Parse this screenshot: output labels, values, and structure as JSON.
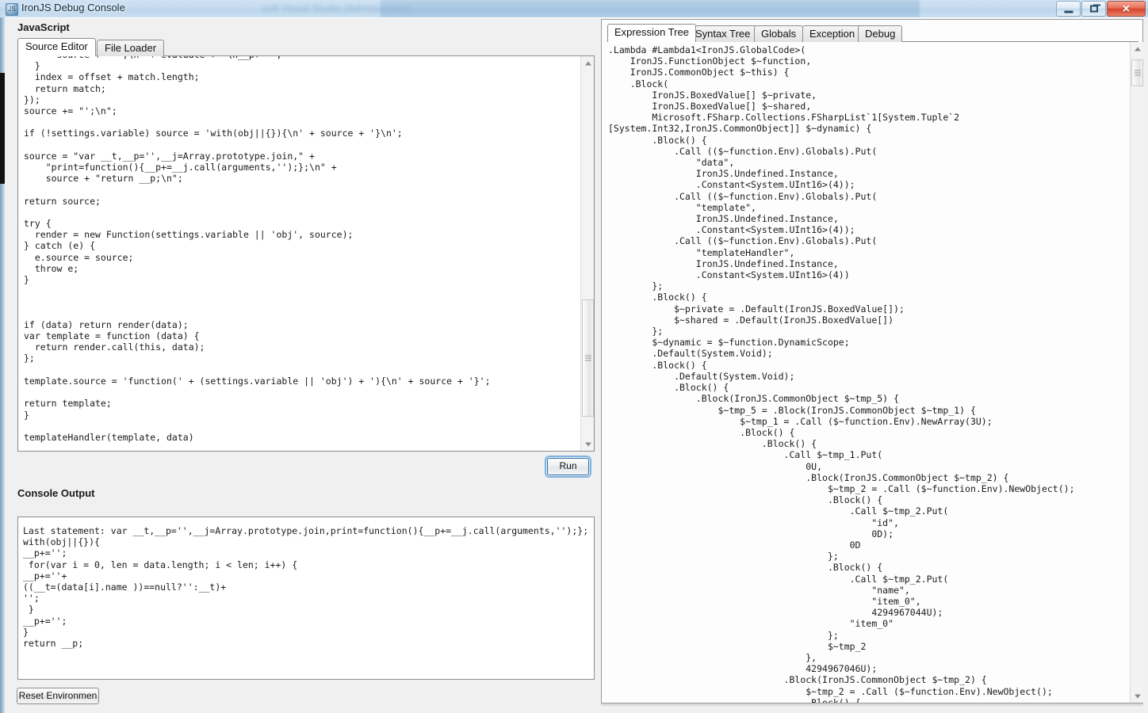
{
  "window": {
    "title": "IronJS Debug Console",
    "ghost_title": "soft Visual Studio (Administrator)",
    "icon": "app-icon",
    "controls": {
      "minimize": "minimize-icon",
      "restore": "restore-icon",
      "close": "close-icon"
    }
  },
  "left": {
    "javascript_label": "JavaScript",
    "console_label": "Console Output",
    "tabs": [
      {
        "label": "Source Editor",
        "active": true
      },
      {
        "label": "File Loader",
        "active": false
      }
    ],
    "run_button": "Run",
    "reset_button": "Reset Environmen",
    "editor_code": "      source += \"';\\n' + evaluate + '\\n__p+='\";\n  }\n  index = offset + match.length;\n  return match;\n});\nsource += \"';\\n\";\n\nif (!settings.variable) source = 'with(obj||{}){\\n' + source + '}\\n';\n\nsource = \"var __t,__p='',__j=Array.prototype.join,\" +\n    \"print=function(){__p+=__j.call(arguments,'');};\\n\" +\n    source + \"return __p;\\n\";\n\nreturn source;\n\ntry {\n  render = new Function(settings.variable || 'obj', source);\n} catch (e) {\n  e.source = source;\n  throw e;\n}\n\n\n\nif (data) return render(data);\nvar template = function (data) {\n  return render.call(this, data);\n};\n\ntemplate.source = 'function(' + (settings.variable || 'obj') + '){\\n' + source + '}';\n\nreturn template;\n}\n\ntemplateHandler(template, data)\n",
    "console_output": "Last statement: var __t,__p='',__j=Array.prototype.join,print=function(){__p+=__j.call(arguments,'');};\nwith(obj||{}){\n__p+='';\n for(var i = 0, len = data.length; i < len; i++) {\n__p+=''+\n((__t=(data[i].name ))==null?'':__t)+\n'';\n }\n__p+='';\n}\nreturn __p;\n"
  },
  "right": {
    "tabs": [
      {
        "label": "Expression Tree",
        "active": true
      },
      {
        "label": "Syntax Tree",
        "active": false
      },
      {
        "label": "Globals",
        "active": false
      },
      {
        "label": "Exception",
        "active": false
      },
      {
        "label": "Debug",
        "active": false
      }
    ],
    "expression_tree": ".Lambda #Lambda1<IronJS.GlobalCode>(\n    IronJS.FunctionObject $~function,\n    IronJS.CommonObject $~this) {\n    .Block(\n        IronJS.BoxedValue[] $~private,\n        IronJS.BoxedValue[] $~shared,\n        Microsoft.FSharp.Collections.FSharpList`1[System.Tuple`2\n[System.Int32,IronJS.CommonObject]] $~dynamic) {\n        .Block() {\n            .Call (($~function.Env).Globals).Put(\n                \"data\",\n                IronJS.Undefined.Instance,\n                .Constant<System.UInt16>(4));\n            .Call (($~function.Env).Globals).Put(\n                \"template\",\n                IronJS.Undefined.Instance,\n                .Constant<System.UInt16>(4));\n            .Call (($~function.Env).Globals).Put(\n                \"templateHandler\",\n                IronJS.Undefined.Instance,\n                .Constant<System.UInt16>(4))\n        };\n        .Block() {\n            $~private = .Default(IronJS.BoxedValue[]);\n            $~shared = .Default(IronJS.BoxedValue[])\n        };\n        $~dynamic = $~function.DynamicScope;\n        .Default(System.Void);\n        .Block() {\n            .Default(System.Void);\n            .Block() {\n                .Block(IronJS.CommonObject $~tmp_5) {\n                    $~tmp_5 = .Block(IronJS.CommonObject $~tmp_1) {\n                        $~tmp_1 = .Call ($~function.Env).NewArray(3U);\n                        .Block() {\n                            .Block() {\n                                .Call $~tmp_1.Put(\n                                    0U,\n                                    .Block(IronJS.CommonObject $~tmp_2) {\n                                        $~tmp_2 = .Call ($~function.Env).NewObject();\n                                        .Block() {\n                                            .Call $~tmp_2.Put(\n                                                \"id\",\n                                                0D);\n                                            0D\n                                        };\n                                        .Block() {\n                                            .Call $~tmp_2.Put(\n                                                \"name\",\n                                                \"item_0\",\n                                                4294967044U);\n                                            \"item_0\"\n                                        };\n                                        $~tmp_2\n                                    },\n                                    4294967046U);\n                                .Block(IronJS.CommonObject $~tmp_2) {\n                                    $~tmp_2 = .Call ($~function.Env).NewObject();\n                                    .Block() {"
  }
}
